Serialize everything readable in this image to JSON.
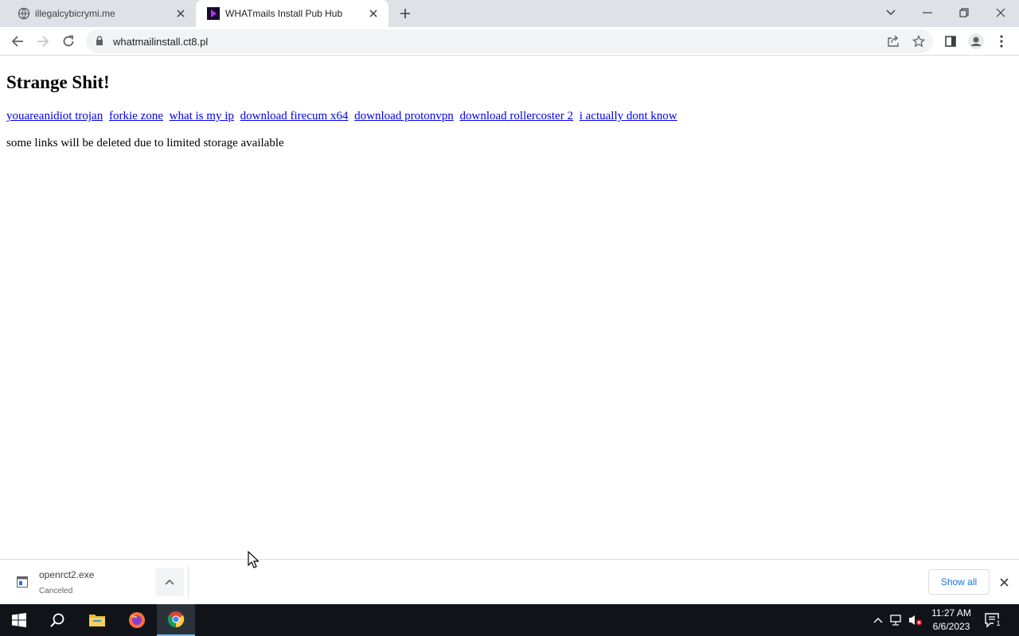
{
  "browser": {
    "tabs": [
      {
        "title": "illegalcybicrymi.me",
        "active": false
      },
      {
        "title": "WHATmails Install Pub Hub",
        "active": true
      }
    ],
    "address_bar": {
      "url": "whatmailinstall.ct8.pl"
    }
  },
  "page": {
    "heading": "Strange Shit!",
    "links": [
      "youareanidiot trojan",
      "forkie zone",
      "what is my ip",
      "download firecum x64",
      "download protonvpn",
      "download rollercoster 2",
      "i actually dont know"
    ],
    "note": "some links will be deleted due to limited storage available"
  },
  "downloads": {
    "items": [
      {
        "filename": "openrct2.exe",
        "status": "Canceled"
      }
    ],
    "show_all_label": "Show all"
  },
  "taskbar": {
    "time": "11:27 AM",
    "date": "6/6/2023",
    "notification_count": "1"
  },
  "colors": {
    "link": "#0000ee",
    "tabstrip": "#dee1e6",
    "accent": "#1a73e8",
    "taskbar": "#101419"
  }
}
